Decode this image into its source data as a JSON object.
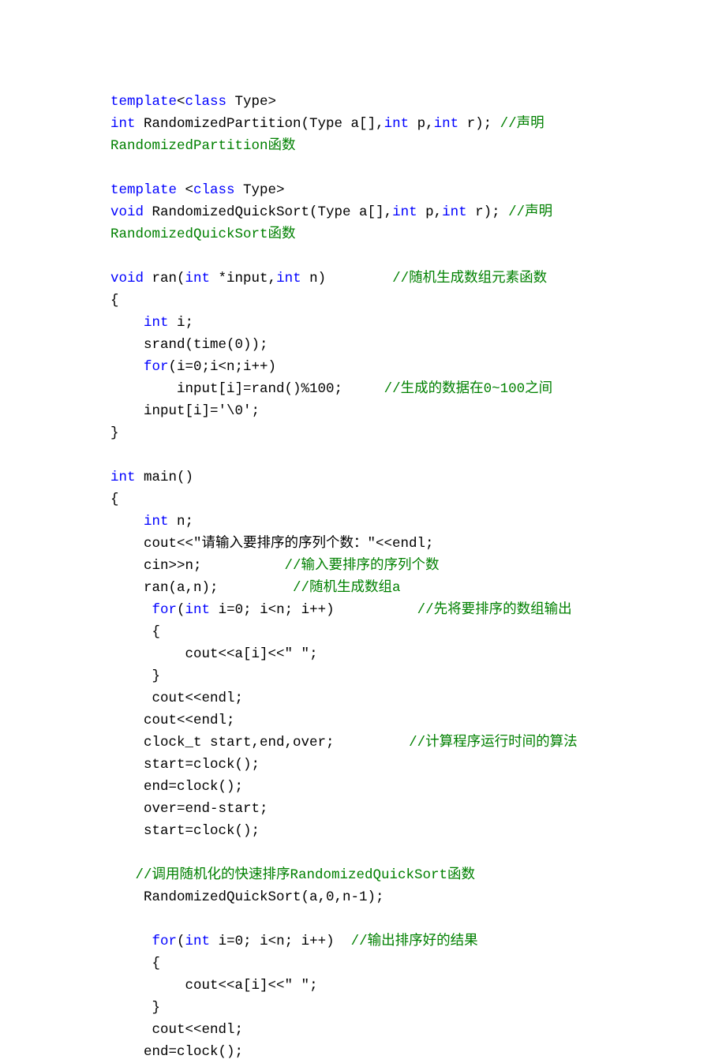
{
  "code_tokens": [
    [
      [
        "kw",
        "template"
      ],
      [
        "tx",
        "<"
      ],
      [
        "kw",
        "class"
      ],
      [
        "tx",
        " Type>"
      ]
    ],
    [
      [
        "kw",
        "int"
      ],
      [
        "tx",
        " RandomizedPartition(Type a[],"
      ],
      [
        "kw",
        "int"
      ],
      [
        "tx",
        " p,"
      ],
      [
        "kw",
        "int"
      ],
      [
        "tx",
        " r); "
      ],
      [
        "cm",
        "//声明"
      ]
    ],
    [
      [
        "cm",
        "RandomizedPartition函数"
      ]
    ],
    [],
    [
      [
        "kw",
        "template"
      ],
      [
        "tx",
        " <"
      ],
      [
        "kw",
        "class"
      ],
      [
        "tx",
        " Type>"
      ]
    ],
    [
      [
        "kw",
        "void"
      ],
      [
        "tx",
        " RandomizedQuickSort(Type a[],"
      ],
      [
        "kw",
        "int"
      ],
      [
        "tx",
        " p,"
      ],
      [
        "kw",
        "int"
      ],
      [
        "tx",
        " r); "
      ],
      [
        "cm",
        "//声明"
      ]
    ],
    [
      [
        "cm",
        "RandomizedQuickSort函数"
      ]
    ],
    [],
    [
      [
        "kw",
        "void"
      ],
      [
        "tx",
        " ran("
      ],
      [
        "kw",
        "int"
      ],
      [
        "tx",
        " *input,"
      ],
      [
        "kw",
        "int"
      ],
      [
        "tx",
        " n)        "
      ],
      [
        "cm",
        "//随机生成数组元素函数"
      ]
    ],
    [
      [
        "tx",
        "{"
      ]
    ],
    [
      [
        "tx",
        "    "
      ],
      [
        "kw",
        "int"
      ],
      [
        "tx",
        " i;"
      ]
    ],
    [
      [
        "tx",
        "    srand(time(0));"
      ]
    ],
    [
      [
        "tx",
        "    "
      ],
      [
        "kw",
        "for"
      ],
      [
        "tx",
        "(i=0;i<n;i++)"
      ]
    ],
    [
      [
        "tx",
        "        input[i]=rand()%100;     "
      ],
      [
        "cm",
        "//生成的数据在0~100之间"
      ]
    ],
    [
      [
        "tx",
        "    input[i]='\\0';"
      ]
    ],
    [
      [
        "tx",
        "}"
      ]
    ],
    [],
    [
      [
        "kw",
        "int"
      ],
      [
        "tx",
        " main()"
      ]
    ],
    [
      [
        "tx",
        "{"
      ]
    ],
    [
      [
        "tx",
        "    "
      ],
      [
        "kw",
        "int"
      ],
      [
        "tx",
        " n;"
      ]
    ],
    [
      [
        "tx",
        "    cout<<"
      ],
      [
        "tx",
        "\"请输入要排序的序列个数：\""
      ],
      [
        "tx",
        "<<endl;"
      ]
    ],
    [
      [
        "tx",
        "    cin>>n;          "
      ],
      [
        "cm",
        "//输入要排序的序列个数"
      ]
    ],
    [
      [
        "tx",
        "    ran(a,n);         "
      ],
      [
        "cm",
        "//随机生成数组a"
      ]
    ],
    [
      [
        "tx",
        "     "
      ],
      [
        "kw",
        "for"
      ],
      [
        "tx",
        "("
      ],
      [
        "kw",
        "int"
      ],
      [
        "tx",
        " i=0; i<n; i++)          "
      ],
      [
        "cm",
        "//先将要排序的数组输出"
      ]
    ],
    [
      [
        "tx",
        "     {"
      ]
    ],
    [
      [
        "tx",
        "         cout<<a[i]<<"
      ],
      [
        "tx",
        "\" \""
      ],
      [
        "tx",
        ";"
      ]
    ],
    [
      [
        "tx",
        "     }"
      ]
    ],
    [
      [
        "tx",
        "     cout<<endl;"
      ]
    ],
    [
      [
        "tx",
        "    cout<<endl;"
      ]
    ],
    [
      [
        "tx",
        "    clock_t start,end,over;         "
      ],
      [
        "cm",
        "//计算程序运行时间的算法"
      ]
    ],
    [
      [
        "tx",
        "    start=clock();"
      ]
    ],
    [
      [
        "tx",
        "    end=clock();"
      ]
    ],
    [
      [
        "tx",
        "    over=end-start;"
      ]
    ],
    [
      [
        "tx",
        "    start=clock();"
      ]
    ],
    [],
    [
      [
        "tx",
        "   "
      ],
      [
        "cm",
        "//调用随机化的快速排序RandomizedQuickSort函数"
      ]
    ],
    [
      [
        "tx",
        "    RandomizedQuickSort(a,0,n-1);"
      ]
    ],
    [],
    [
      [
        "tx",
        "     "
      ],
      [
        "kw",
        "for"
      ],
      [
        "tx",
        "("
      ],
      [
        "kw",
        "int"
      ],
      [
        "tx",
        " i=0; i<n; i++)  "
      ],
      [
        "cm",
        "//输出排序好的结果"
      ]
    ],
    [
      [
        "tx",
        "     {"
      ]
    ],
    [
      [
        "tx",
        "         cout<<a[i]<<"
      ],
      [
        "tx",
        "\" \""
      ],
      [
        "tx",
        ";"
      ]
    ],
    [
      [
        "tx",
        "     }"
      ]
    ],
    [
      [
        "tx",
        "     cout<<endl;"
      ]
    ],
    [
      [
        "tx",
        "    end=clock();"
      ]
    ]
  ]
}
